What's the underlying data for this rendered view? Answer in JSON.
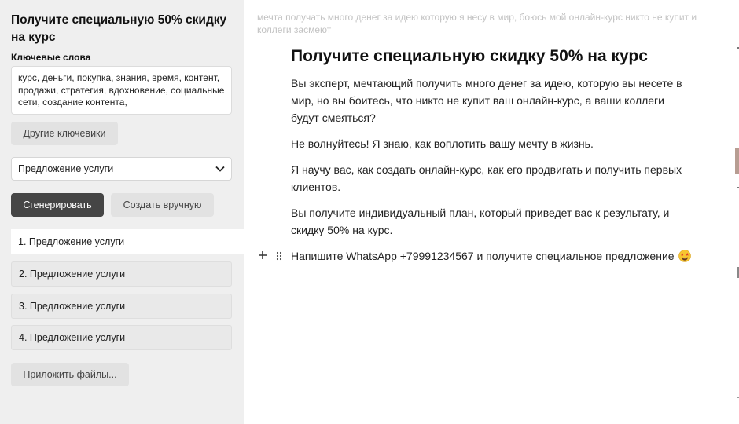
{
  "sidebar": {
    "title": "Получите специальную 50% скидку на курс",
    "keywords_label": "Ключевые слова",
    "keywords_value": "курс, деньги, покупка, знания, время, контент, продажи, стратегия, вдохновение, социальные сети, создание контента,",
    "other_keywords_button": "Другие ключевики",
    "select_value": "Предложение услуги",
    "generate_button": "Сгенерировать",
    "manual_button": "Создать вручную",
    "variants": [
      {
        "label": "1. Предложение услуги"
      },
      {
        "label": "2. Предложение услуги"
      },
      {
        "label": "3. Предложение услуги"
      },
      {
        "label": "4. Предложение услуги"
      }
    ],
    "attach_button": "Приложить файлы..."
  },
  "editor": {
    "prompt": "мечта получать много денег за идею которую я несу в мир, боюсь мой онлайн-курс никто не купит и коллеги засмеют",
    "heading": "Получите специальную скидку 50% на курс",
    "paragraphs": [
      "Вы эксперт, мечтающий получить много денег за идею, которую вы несете в мир, но вы боитесь, что никто не купит ваш онлайн-курс, а ваши коллеги будут смеяться?",
      "Не волнуйтесь! Я знаю, как воплотить вашу мечту в жизнь.",
      "Я научу вас, как создать онлайн-курс, как его продвигать и получить первых клиентов.",
      "Вы получите индивидуальный план, который приведет вас к результату, и скидку 50% на курс.",
      "Напишите WhatsApp +79991234567 и получите специальное предложение"
    ],
    "last_line_emoji": "star-struck-emoji-icon"
  },
  "colors": {
    "sidebar_bg": "#efefef",
    "primary_button": "#454545",
    "secondary_button": "#e2e2e2",
    "prompt_text": "#c2c2c2"
  }
}
